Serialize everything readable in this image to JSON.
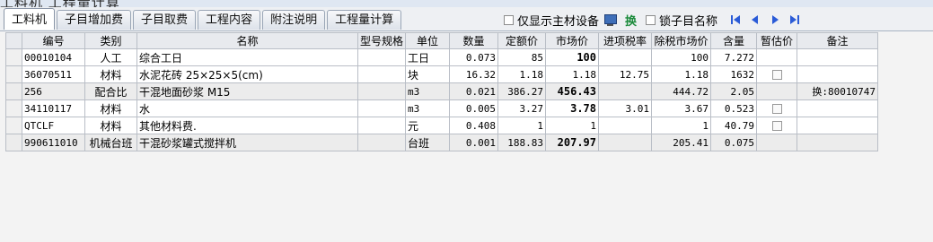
{
  "window": {
    "title_fragment": "工料机 工程量计算"
  },
  "tabs": [
    {
      "label": "工料机",
      "active": true
    },
    {
      "label": "子目增加费",
      "active": false
    },
    {
      "label": "子目取费",
      "active": false
    },
    {
      "label": "工程内容",
      "active": false
    },
    {
      "label": "附注说明",
      "active": false
    },
    {
      "label": "工程量计算",
      "active": false
    }
  ],
  "toolbar": {
    "main_material_label": "仅显示主材设备",
    "main_material_checked": false,
    "swap_label": "换",
    "lock_name_label": "锁子目名称",
    "lock_name_checked": false
  },
  "grid": {
    "columns": [
      "编号",
      "类别",
      "名称",
      "型号规格",
      "单位",
      "数量",
      "定额价",
      "市场价",
      "进项税率",
      "除税市场价",
      "含量",
      "暂估价",
      "备注"
    ],
    "rows": [
      {
        "code": "00010104",
        "category": "人工",
        "name": "综合工日",
        "spec": "",
        "unit": "工日",
        "quantity": "0.073",
        "quota_price": "85",
        "market_price": "100",
        "input_tax": "",
        "ex_tax_price": "100",
        "content": "7.272",
        "provisional": false,
        "has_checkbox": false,
        "remark": "",
        "shaded": false
      },
      {
        "code": "36070511",
        "category": "材料",
        "name": "水泥花砖 25×25×5(cm)",
        "spec": "",
        "unit": "块",
        "quantity": "16.32",
        "quota_price": "1.18",
        "market_price": "1.18",
        "input_tax": "12.75",
        "ex_tax_price": "1.18",
        "content": "1632",
        "provisional": false,
        "has_checkbox": true,
        "remark": "",
        "shaded": false
      },
      {
        "code": "256",
        "category": "配合比",
        "name": "干混地面砂浆 M15",
        "spec": "",
        "unit": "m3",
        "quantity": "0.021",
        "quota_price": "386.27",
        "market_price": "456.43",
        "input_tax": "",
        "ex_tax_price": "444.72",
        "content": "2.05",
        "provisional": false,
        "has_checkbox": false,
        "remark": "换:80010747",
        "shaded": true
      },
      {
        "code": "34110117",
        "category": "材料",
        "name": "水",
        "spec": "",
        "unit": "m3",
        "quantity": "0.005",
        "quota_price": "3.27",
        "market_price": "3.78",
        "input_tax": "3.01",
        "ex_tax_price": "3.67",
        "content": "0.523",
        "provisional": false,
        "has_checkbox": true,
        "remark": "",
        "shaded": false
      },
      {
        "code": "QTCLF",
        "category": "材料",
        "name": "其他材料费.",
        "spec": "",
        "unit": "元",
        "quantity": "0.408",
        "quota_price": "1",
        "market_price": "1",
        "input_tax": "",
        "ex_tax_price": "1",
        "content": "40.79",
        "provisional": false,
        "has_checkbox": true,
        "remark": "",
        "shaded": false
      },
      {
        "code": "990611010",
        "category": "机械台班",
        "name": "干混砂浆罐式搅拌机",
        "spec": "",
        "unit": "台班",
        "quantity": "0.001",
        "quota_price": "188.83",
        "market_price": "207.97",
        "input_tax": "",
        "ex_tax_price": "205.41",
        "content": "0.075",
        "provisional": false,
        "has_checkbox": false,
        "remark": "",
        "shaded": true
      }
    ]
  },
  "colors": {
    "shaded_row": "#ececec",
    "grid_line": "#b9bec6",
    "tab_border": "#9aa6b6",
    "nav_blue": "#2a5bd7",
    "swap_green": "#1a8a3a"
  }
}
